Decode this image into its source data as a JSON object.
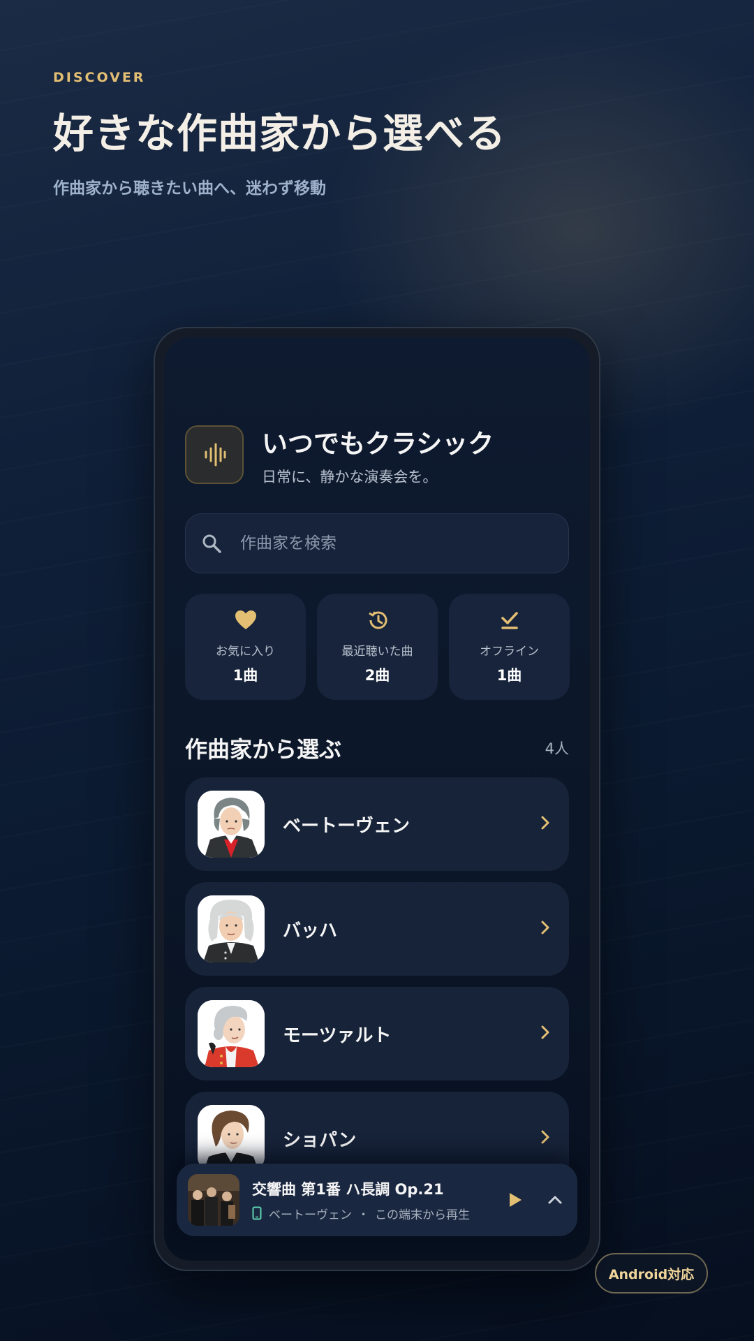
{
  "hero": {
    "eyebrow": "DISCOVER",
    "title": "好きな作曲家から選べる",
    "subtitle": "作曲家から聴きたい曲へ、迷わず移動"
  },
  "app": {
    "title": "いつでもクラシック",
    "tagline": "日常に、静かな演奏会を。",
    "icon": "waveform-icon"
  },
  "search": {
    "placeholder": "作曲家を検索",
    "value": ""
  },
  "stats": [
    {
      "icon": "heart-icon",
      "label": "お気に入り",
      "value": "1曲"
    },
    {
      "icon": "history-icon",
      "label": "最近聴いた曲",
      "value": "2曲"
    },
    {
      "icon": "offline-download-icon",
      "label": "オフライン",
      "value": "1曲"
    }
  ],
  "composers_section": {
    "title": "作曲家から選ぶ",
    "count": "4人",
    "items": [
      {
        "name": "ベートーヴェン"
      },
      {
        "name": "バッハ"
      },
      {
        "name": "モーツァルト"
      },
      {
        "name": "ショパン"
      }
    ]
  },
  "now_playing": {
    "title": "交響曲 第1番 ハ長調 Op.21",
    "composer": "ベートーヴェン",
    "separator": "・",
    "device": "この端末から再生"
  },
  "badge": {
    "label": "Android対応"
  },
  "colors": {
    "accent": "#e3bf73",
    "background": "#0b1a30",
    "card": "#172339"
  }
}
